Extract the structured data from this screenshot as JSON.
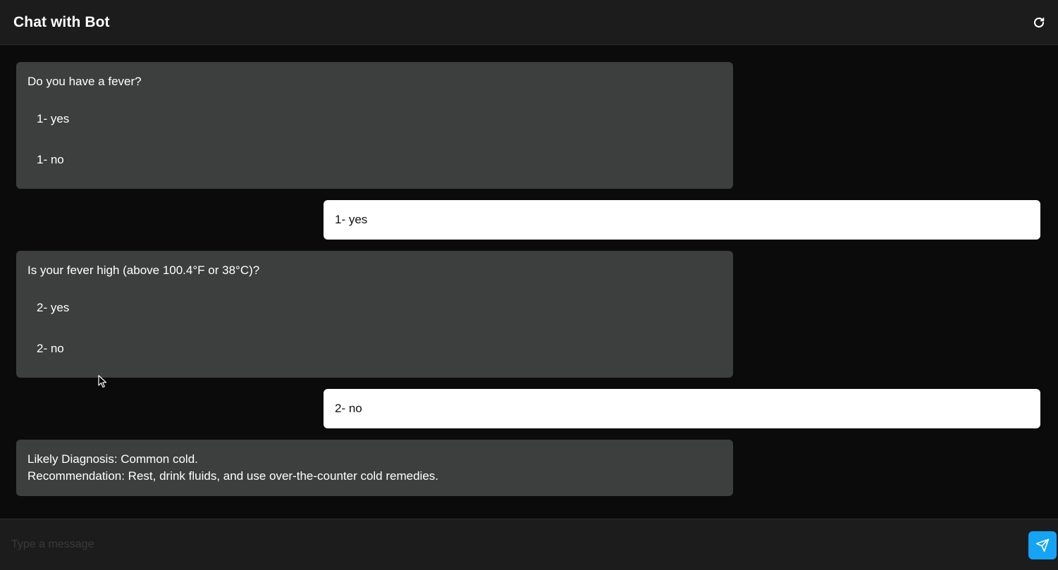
{
  "header": {
    "title": "Chat with Bot",
    "refresh_icon": "refresh-icon"
  },
  "messages": [
    {
      "sender": "bot",
      "question": "Do you have a fever?",
      "options": [
        "1- yes",
        "1- no"
      ]
    },
    {
      "sender": "user",
      "text": "1- yes"
    },
    {
      "sender": "bot",
      "question": "Is your fever high (above 100.4°F or 38°C)?",
      "options": [
        "2- yes",
        "2- no"
      ]
    },
    {
      "sender": "user",
      "text": "2- no"
    },
    {
      "sender": "bot",
      "lines": [
        "Likely Diagnosis: Common cold.",
        "Recommendation: Rest, drink fluids, and use over-the-counter cold remedies."
      ]
    }
  ],
  "composer": {
    "placeholder": "Type a message",
    "send_icon": "send-icon"
  },
  "colors": {
    "background": "#0b0b0b",
    "header": "#1c1c1c",
    "bot_bubble": "#3d3f3e",
    "user_bubble": "#ffffff",
    "accent": "#14a3f5"
  }
}
